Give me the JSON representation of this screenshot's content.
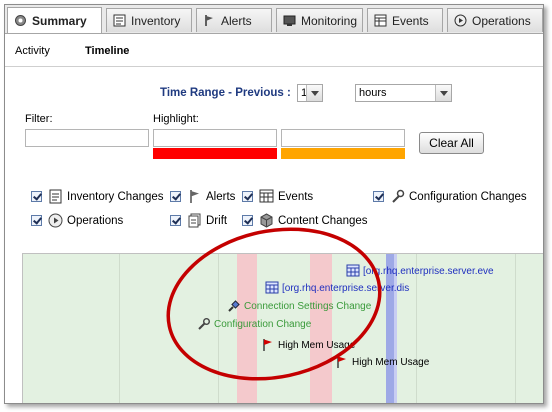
{
  "tabs": [
    {
      "label": "Summary",
      "icon": "gear-icon",
      "active": true
    },
    {
      "label": "Inventory",
      "icon": "inventory-icon",
      "active": false
    },
    {
      "label": "Alerts",
      "icon": "flag-icon",
      "active": false
    },
    {
      "label": "Monitoring",
      "icon": "monitor-icon",
      "active": false
    },
    {
      "label": "Events",
      "icon": "events-icon",
      "active": false
    },
    {
      "label": "Operations",
      "icon": "play-icon",
      "active": false
    }
  ],
  "subnav": {
    "activity": "Activity",
    "timeline": "Timeline"
  },
  "time_range": {
    "label": "Time Range - Previous :",
    "value": "1",
    "unit": "hours"
  },
  "filter": {
    "label": "Filter:",
    "value": ""
  },
  "highlight": {
    "label": "Highlight:",
    "value1": "",
    "value2": "",
    "color1": "#ff0000",
    "color2": "#ffa500"
  },
  "clear_all": "Clear All",
  "checkboxes": [
    {
      "label": "Inventory Changes",
      "icon": "inventory-icon",
      "checked": true
    },
    {
      "label": "Alerts",
      "icon": "flag-icon",
      "checked": true
    },
    {
      "label": "Events",
      "icon": "events-icon",
      "checked": true
    },
    {
      "label": "Configuration Changes",
      "icon": "wrench-icon",
      "checked": true
    },
    {
      "label": "Operations",
      "icon": "play-icon",
      "checked": true
    },
    {
      "label": "Drift",
      "icon": "drift-icon",
      "checked": true
    },
    {
      "label": "Content Changes",
      "icon": "package-icon",
      "checked": true
    }
  ],
  "timeline_events": [
    {
      "label": "[org.rhq.enterprise.server.eve",
      "icon": "events-icon",
      "color": "#1f2fbf"
    },
    {
      "label": "[org.rhq.enterprise.server.dis",
      "icon": "events-icon",
      "color": "#1f2fbf"
    },
    {
      "label": "Connection Settings Change",
      "icon": "connection-icon",
      "color": "#3a9a3a"
    },
    {
      "label": "Configuration Change",
      "icon": "wrench-icon",
      "color": "#3a9a3a"
    },
    {
      "label": "High Mem Usage",
      "icon": "flag-icon",
      "color": "#000000"
    },
    {
      "label": "High Mem Usage",
      "icon": "flag-icon",
      "color": "#000000"
    }
  ],
  "colors": {
    "timeline_bg": "#e3f1e1",
    "band_pink": "#f4c9cc",
    "band_blue": "#9ea9e6",
    "annotation": "#c40000"
  }
}
